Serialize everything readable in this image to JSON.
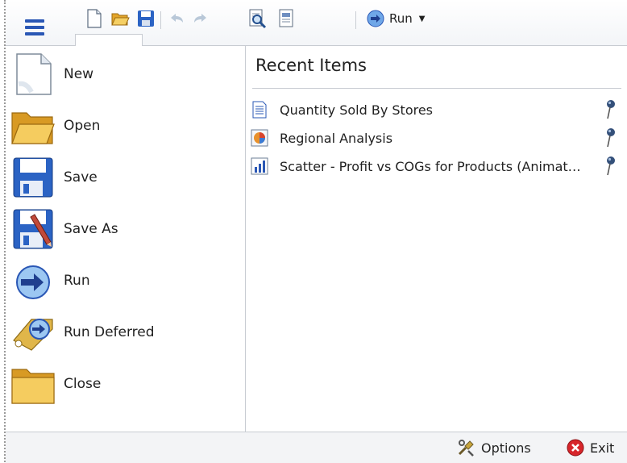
{
  "toolbar": {
    "items": [
      {
        "name": "new-document-icon"
      },
      {
        "name": "open-folder-icon"
      },
      {
        "name": "save-icon"
      },
      {
        "name": "undo-icon"
      },
      {
        "name": "redo-icon"
      },
      {
        "name": "preview-icon"
      },
      {
        "name": "properties-icon"
      }
    ],
    "run_label": "Run"
  },
  "commands": [
    {
      "id": "new",
      "label": "New",
      "icon": "new-document-icon"
    },
    {
      "id": "open",
      "label": "Open",
      "icon": "open-folder-icon"
    },
    {
      "id": "save",
      "label": "Save",
      "icon": "save-icon"
    },
    {
      "id": "save-as",
      "label": "Save As",
      "icon": "save-as-icon"
    },
    {
      "id": "run",
      "label": "Run",
      "icon": "run-icon"
    },
    {
      "id": "run-deferred",
      "label": "Run Deferred",
      "icon": "run-deferred-icon"
    },
    {
      "id": "close",
      "label": "Close",
      "icon": "close-folder-icon"
    }
  ],
  "recent": {
    "title": "Recent Items",
    "items": [
      {
        "label": "Quantity Sold By Stores",
        "icon": "report-document-icon"
      },
      {
        "label": "Regional Analysis",
        "icon": "chart-report-icon"
      },
      {
        "label": "Scatter - Profit vs COGs for Products (Animated)",
        "icon": "bar-chart-icon"
      }
    ]
  },
  "bottom": {
    "options_label": "Options",
    "exit_label": "Exit"
  },
  "colors": {
    "accent_blue": "#2a57b5",
    "exit_red": "#d7262b",
    "folder_yellow": "#f0c64a",
    "border_gray": "#c8ccd2"
  }
}
